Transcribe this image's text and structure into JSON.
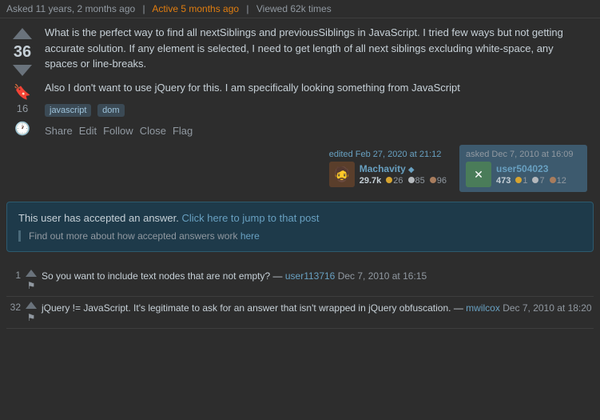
{
  "topbar": {
    "asked": "Asked 11 years, 2 months ago",
    "active": "Active 5 months ago",
    "viewed": "Viewed 62k times"
  },
  "question": {
    "vote_count": "36",
    "bookmark_count": "16",
    "body_p1": "What is the perfect way to find all nextSiblings and previousSiblings in JavaScript. I tried few ways but not getting accurate solution. If any element is selected, I need to get length of all next siblings excluding white-space, any spaces or line-breaks.",
    "body_p2": "Also I don't want to use jQuery for this. I am specifically looking something from JavaScript",
    "tags": [
      "javascript",
      "dom"
    ],
    "actions": {
      "share": "Share",
      "edit": "Edit",
      "follow": "Follow",
      "close": "Close",
      "flag": "Flag"
    },
    "editor": {
      "label": "edited Feb 27, 2020 at 21:12",
      "username": "Machavity",
      "diamond": "◆",
      "rep": "29.7k",
      "gold": "26",
      "silver": "85",
      "bronze": "96"
    },
    "asker": {
      "label": "asked Dec 7, 2010 at 16:09",
      "username": "user504023",
      "rep": "473",
      "gold": "1",
      "silver": "7",
      "bronze": "12"
    }
  },
  "accepted_notice": {
    "main": "This user has accepted an answer.",
    "link": "Click here to jump to that post",
    "sub": "Find out more about how accepted answers work",
    "sub_link": "here"
  },
  "comments": [
    {
      "num": "1",
      "text": "So you want to include text nodes that are not empty?",
      "user": "user113716",
      "date": "Dec 7, 2010 at 16:15"
    },
    {
      "num": "32",
      "text": "jQuery != JavaScript. It's legitimate to ask for an answer that isn't wrapped in jQuery obfuscation.",
      "user": "mwilcox",
      "date": "Dec 7, 2010 at 18:20"
    }
  ]
}
